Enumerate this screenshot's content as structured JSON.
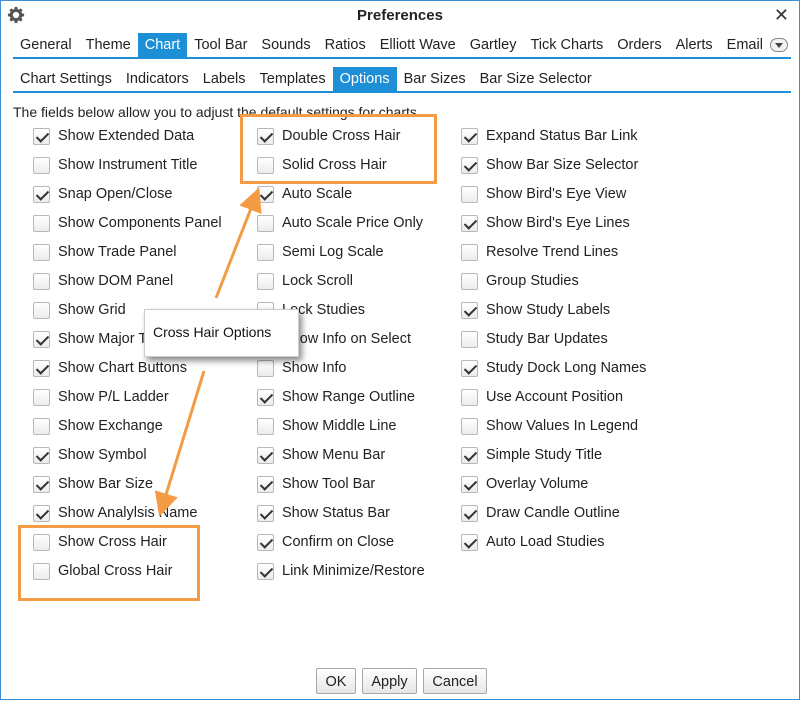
{
  "window": {
    "title": "Preferences"
  },
  "main_tabs": [
    {
      "label": "General",
      "active": false
    },
    {
      "label": "Theme",
      "active": false
    },
    {
      "label": "Chart",
      "active": true
    },
    {
      "label": "Tool Bar",
      "active": false
    },
    {
      "label": "Sounds",
      "active": false
    },
    {
      "label": "Ratios",
      "active": false
    },
    {
      "label": "Elliott Wave",
      "active": false
    },
    {
      "label": "Gartley",
      "active": false
    },
    {
      "label": "Tick Charts",
      "active": false
    },
    {
      "label": "Orders",
      "active": false
    },
    {
      "label": "Alerts",
      "active": false
    },
    {
      "label": "Email",
      "active": false
    }
  ],
  "sub_tabs": [
    {
      "label": "Chart Settings",
      "active": false
    },
    {
      "label": "Indicators",
      "active": false
    },
    {
      "label": "Labels",
      "active": false
    },
    {
      "label": "Templates",
      "active": false
    },
    {
      "label": "Options",
      "active": true
    },
    {
      "label": "Bar Sizes",
      "active": false
    },
    {
      "label": "Bar Size Selector",
      "active": false
    }
  ],
  "intro_text": "The fields below allow you to adjust the default settings for charts.",
  "columns": [
    [
      {
        "label": "Show Extended Data",
        "checked": true
      },
      {
        "label": "Show Instrument Title",
        "checked": false
      },
      {
        "label": "Snap Open/Close",
        "checked": true
      },
      {
        "label": "Show Components Panel",
        "checked": false
      },
      {
        "label": "Show Trade Panel",
        "checked": false
      },
      {
        "label": "Show DOM Panel",
        "checked": false
      },
      {
        "label": "Show Grid",
        "checked": false
      },
      {
        "label": "Show Major Ticks",
        "checked": true
      },
      {
        "label": "Show Chart Buttons",
        "checked": true
      },
      {
        "label": "Show P/L Ladder",
        "checked": false
      },
      {
        "label": "Show Exchange",
        "checked": false
      },
      {
        "label": "Show Symbol",
        "checked": true
      },
      {
        "label": "Show Bar Size",
        "checked": true
      },
      {
        "label": "Show Analylsis Name",
        "checked": true
      },
      {
        "label": "Show Cross Hair",
        "checked": false
      },
      {
        "label": "Global Cross Hair",
        "checked": false
      }
    ],
    [
      {
        "label": "Double Cross Hair",
        "checked": true
      },
      {
        "label": "Solid Cross Hair",
        "checked": false
      },
      {
        "label": "Auto Scale",
        "checked": true
      },
      {
        "label": "Auto Scale Price Only",
        "checked": false
      },
      {
        "label": "Semi Log Scale",
        "checked": false
      },
      {
        "label": "Lock Scroll",
        "checked": false
      },
      {
        "label": "Lock Studies",
        "checked": false
      },
      {
        "label": "Show Info on Select",
        "checked": false
      },
      {
        "label": "Show Info",
        "checked": false
      },
      {
        "label": "Show Range Outline",
        "checked": true
      },
      {
        "label": "Show Middle Line",
        "checked": false
      },
      {
        "label": "Show Menu Bar",
        "checked": true
      },
      {
        "label": "Show Tool Bar",
        "checked": true
      },
      {
        "label": "Show Status Bar",
        "checked": true
      },
      {
        "label": "Confirm on Close",
        "checked": true
      },
      {
        "label": "Link Minimize/Restore",
        "checked": true
      }
    ],
    [
      {
        "label": "Expand Status Bar Link",
        "checked": true
      },
      {
        "label": "Show Bar Size Selector",
        "checked": true
      },
      {
        "label": "Show Bird's Eye View",
        "checked": false
      },
      {
        "label": "Show Bird's Eye Lines",
        "checked": true
      },
      {
        "label": "Resolve Trend Lines",
        "checked": false
      },
      {
        "label": "Group Studies",
        "checked": false
      },
      {
        "label": "Show Study Labels",
        "checked": true
      },
      {
        "label": "Study Bar Updates",
        "checked": false
      },
      {
        "label": "Study Dock Long Names",
        "checked": true
      },
      {
        "label": "Use Account Position",
        "checked": false
      },
      {
        "label": "Show Values In Legend",
        "checked": false
      },
      {
        "label": "Simple Study Title",
        "checked": true
      },
      {
        "label": "Overlay Volume",
        "checked": true
      },
      {
        "label": "Draw Candle Outline",
        "checked": true
      },
      {
        "label": "Auto Load Studies",
        "checked": true
      }
    ]
  ],
  "annotation": {
    "callout_text": "Cross Hair Options",
    "accent_color": "#f39c45"
  },
  "buttons": {
    "ok": "OK",
    "apply": "Apply",
    "cancel": "Cancel"
  },
  "colors": {
    "tab_active": "#1c8fd6",
    "window_border": "#3a8fd6"
  }
}
